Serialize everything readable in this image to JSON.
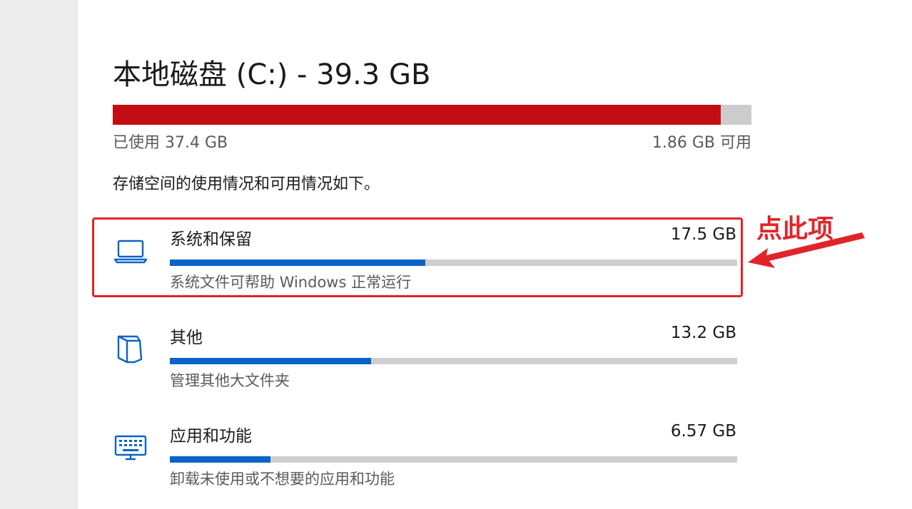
{
  "drive": {
    "title": "本地磁盘 (C:) - 39.3 GB",
    "used_label": "已使用 37.4 GB",
    "free_label": "1.86 GB 可用",
    "used_fraction": 0.952,
    "bar_color": "#c40d12"
  },
  "storage_description": "存储空间的使用情况和可用情况如下。",
  "categories": [
    {
      "name": "系统和保留",
      "size": "17.5 GB",
      "description": "系统文件可帮助 Windows 正常运行",
      "usage_fraction": 0.45,
      "icon": "laptop-icon"
    },
    {
      "name": "其他",
      "size": "13.2 GB",
      "description": "管理其他大文件夹",
      "usage_fraction": 0.355,
      "icon": "folder-icon"
    },
    {
      "name": "应用和功能",
      "size": "6.57 GB",
      "description": "卸载未使用或不想要的应用和功能",
      "usage_fraction": 0.177,
      "icon": "keyboard-icon"
    }
  ],
  "annotation": {
    "text": "点此项",
    "color": "#e0252a"
  },
  "colors": {
    "accent": "#0a64c8",
    "bar_track": "#cfcfcf"
  }
}
